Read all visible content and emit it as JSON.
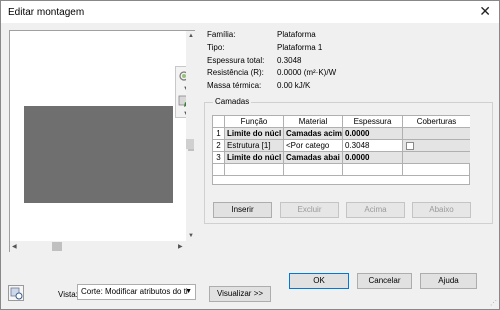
{
  "window": {
    "title": "Editar montagem",
    "close_glyph": "✕"
  },
  "properties": [
    {
      "label": "Família:",
      "value": "Plataforma"
    },
    {
      "label": "Tipo:",
      "value": "Plataforma 1"
    },
    {
      "label": "Espessura total:",
      "value": "0.3048"
    },
    {
      "label": "Resistência (R):",
      "value": "0.0000 (m²·K)/W"
    },
    {
      "label": "Massa térmica:",
      "value": "0.00 kJ/K"
    }
  ],
  "layers": {
    "group_label": "Camadas",
    "columns": [
      "Função",
      "Material",
      "Espessura",
      "Coberturas"
    ],
    "rows": [
      {
        "num": "1",
        "funcao": "Limite do núcl",
        "material": "Camadas acim",
        "espessura": "0.0000",
        "coberturas": ""
      },
      {
        "num": "2",
        "funcao": "Estrutura [1]",
        "material": "<Por catego",
        "espessura": "0.3048",
        "coberturas": ""
      },
      {
        "num": "3",
        "funcao": "Limite do núcl",
        "material": "Camadas abai",
        "espessura": "0.0000",
        "coberturas": ""
      }
    ]
  },
  "layer_buttons": {
    "insert": "Inserir",
    "delete": "Excluir",
    "up": "Acima",
    "down": "Abaixo"
  },
  "footer": {
    "vista_label": "Vista:",
    "vista_value": "Corte: Modificar atributos do ti",
    "preview_button": "Visualizar >>",
    "ok": "OK",
    "cancel": "Cancelar",
    "help": "Ajuda"
  },
  "icons": {
    "zoom": "zoom-icon",
    "pan": "pan-icon",
    "help": "help-icon",
    "dropdown": "chevron-down-icon"
  }
}
